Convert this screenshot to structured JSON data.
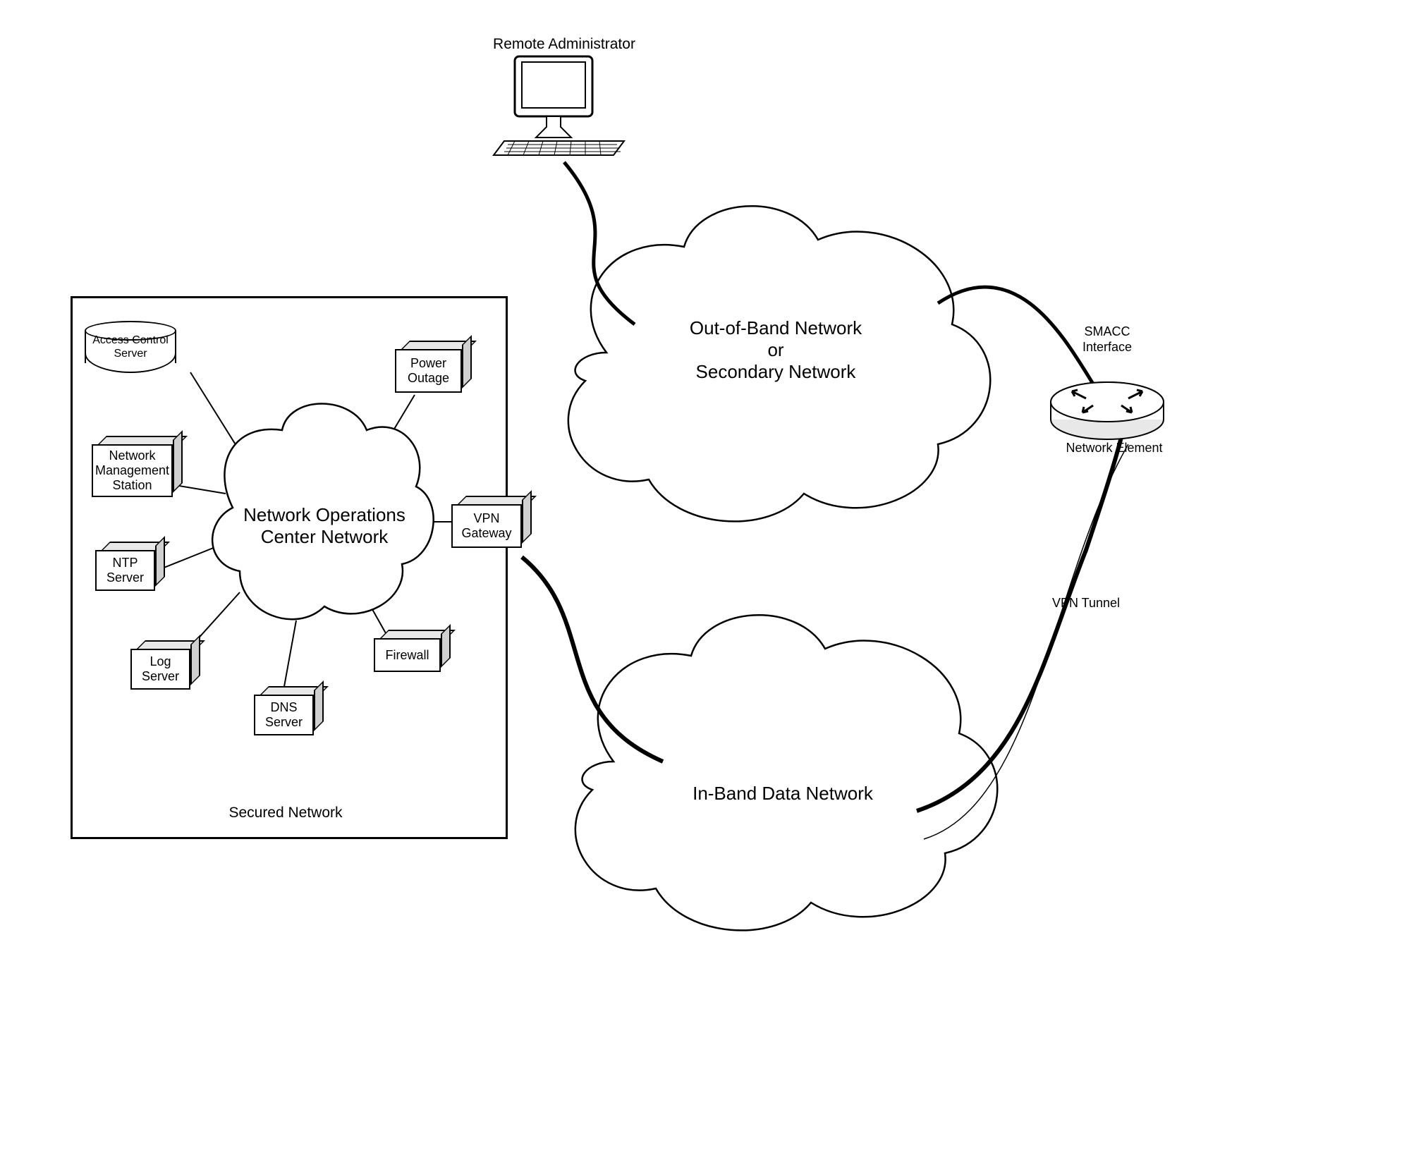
{
  "topLabel": "Remote Administrator",
  "securedNetworkLabel": "Secured Network",
  "nocCloudLabel": "Network Operations\nCenter Network",
  "oobCloud": "Out-of-Band Network\nor\nSecondary Network",
  "inbandCloud": "In-Band Data Network",
  "smaccLabel": "SMACC\nInterface",
  "networkElementLabel": "Network Element",
  "vpnTunnelLabel": "VPN Tunnel",
  "boxes": {
    "accessControl": "Access Control\nServer",
    "powerOutage": "Power\nOutage",
    "nms": "Network\nManagement\nStation",
    "vpnGateway": "VPN\nGateway",
    "ntpServer": "NTP\nServer",
    "logServer": "Log\nServer",
    "dnsServer": "DNS\nServer",
    "firewall": "Firewall"
  }
}
